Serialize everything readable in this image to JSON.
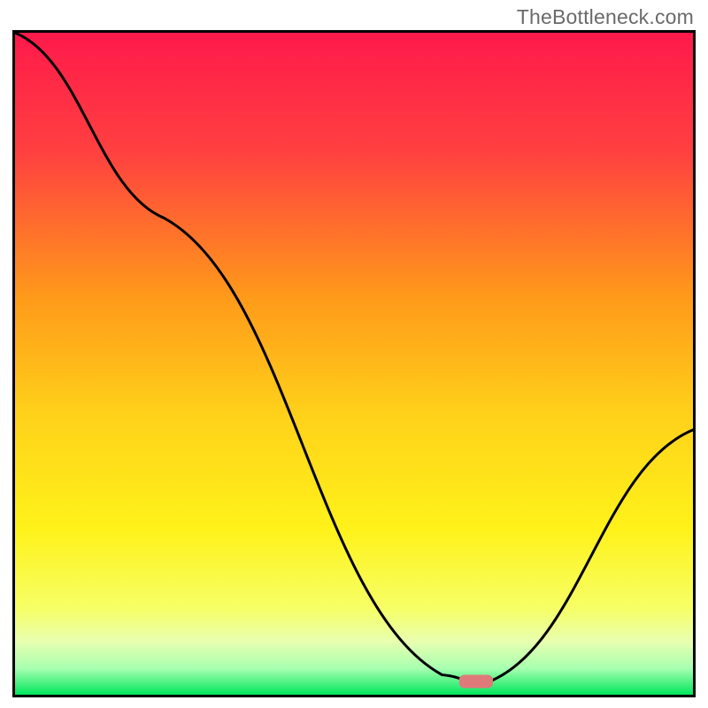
{
  "watermark": "TheBottleneck.com",
  "chart_data": {
    "type": "line",
    "title": "",
    "xlabel": "",
    "ylabel": "",
    "xlim": [
      0,
      100
    ],
    "ylim": [
      0,
      100
    ],
    "grid": false,
    "series": [
      {
        "name": "bottleneck-curve",
        "x": [
          0,
          22,
          63,
          68,
          70,
          100
        ],
        "y": [
          100,
          72,
          3,
          2,
          2,
          40
        ]
      }
    ],
    "marker": {
      "name": "optimal-point",
      "x": 68,
      "y": 2,
      "color": "#e07a7a",
      "width": 5,
      "height": 2
    },
    "background_gradient": {
      "stops": [
        {
          "offset": 0.0,
          "color": "#ff1a4b"
        },
        {
          "offset": 0.18,
          "color": "#ff4040"
        },
        {
          "offset": 0.4,
          "color": "#ff9a1a"
        },
        {
          "offset": 0.58,
          "color": "#ffd21a"
        },
        {
          "offset": 0.75,
          "color": "#fff21a"
        },
        {
          "offset": 0.87,
          "color": "#f6ff66"
        },
        {
          "offset": 0.92,
          "color": "#e8ffb0"
        },
        {
          "offset": 0.96,
          "color": "#a8ffb0"
        },
        {
          "offset": 1.0,
          "color": "#00e65c"
        }
      ]
    }
  }
}
